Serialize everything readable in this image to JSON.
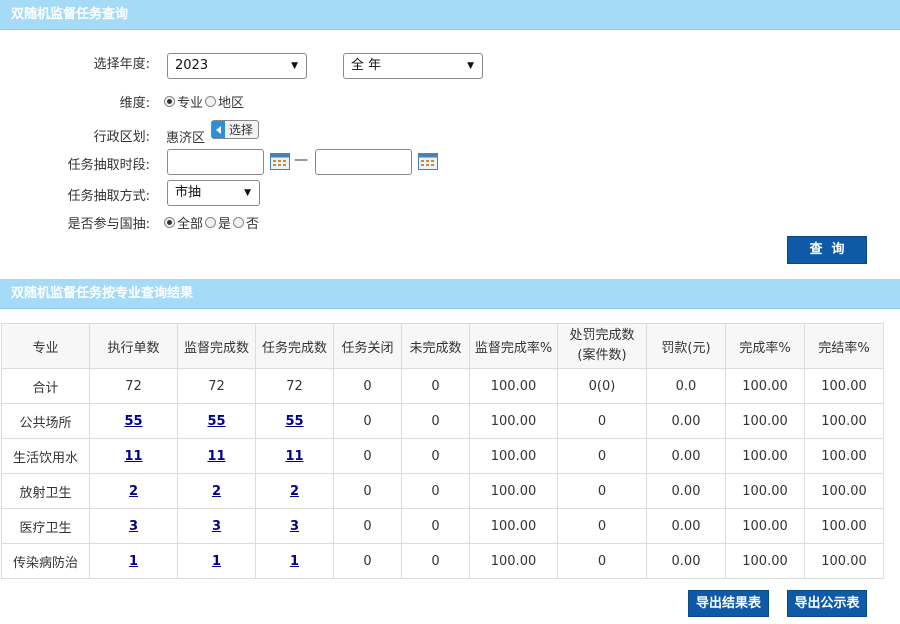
{
  "query_panel": {
    "title": "双随机监督任务查询"
  },
  "form": {
    "year": {
      "label": "选择年度:",
      "value": "2023"
    },
    "period": {
      "value": "全 年"
    },
    "dimension": {
      "label": "维度:",
      "options": [
        "专业",
        "地区"
      ],
      "selected": "专业"
    },
    "region": {
      "label": "行政区划:",
      "value": "惠济区",
      "select_button": "选择"
    },
    "time_range": {
      "label": "任务抽取时段:",
      "separator": "—",
      "start": "",
      "end": ""
    },
    "method": {
      "label": "任务抽取方式:",
      "value": "市抽"
    },
    "national": {
      "label": "是否参与国抽:",
      "options": [
        "全部",
        "是",
        "否"
      ],
      "selected": "全部"
    },
    "query_button": "查  询"
  },
  "results_panel": {
    "title": "双随机监督任务按专业查询结果"
  },
  "table": {
    "headers": [
      "专业",
      "执行单数",
      "监督完成数",
      "任务完成数",
      "任务关闭",
      "未完成数",
      "监督完成率%",
      "处罚完成数\n(案件数)",
      "罚款(元)",
      "完成率%",
      "完结率%"
    ],
    "rows": [
      [
        "合计",
        "72",
        "72",
        "72",
        "0",
        "0",
        "100.00",
        "0(0)",
        "0.0",
        "100.00",
        "100.00"
      ],
      [
        "公共场所",
        "55",
        "55",
        "55",
        "0",
        "0",
        "100.00",
        "0",
        "0.00",
        "100.00",
        "100.00"
      ],
      [
        "生活饮用水",
        "11",
        "11",
        "11",
        "0",
        "0",
        "100.00",
        "0",
        "0.00",
        "100.00",
        "100.00"
      ],
      [
        "放射卫生",
        "2",
        "2",
        "2",
        "0",
        "0",
        "100.00",
        "0",
        "0.00",
        "100.00",
        "100.00"
      ],
      [
        "医疗卫生",
        "3",
        "3",
        "3",
        "0",
        "0",
        "100.00",
        "0",
        "0.00",
        "100.00",
        "100.00"
      ],
      [
        "传染病防治",
        "1",
        "1",
        "1",
        "0",
        "0",
        "100.00",
        "0",
        "0.00",
        "100.00",
        "100.00"
      ]
    ]
  },
  "footer": {
    "export_results": "导出结果表",
    "export_public": "导出公示表"
  },
  "icons": {
    "calendar": "calendar-icon",
    "dropdown": "chevron-down-icon",
    "select_arrow": "triangle-left-icon"
  },
  "colors": {
    "header_bg": "#a6dbf7",
    "button_bg": "#0e5aa7",
    "link": "#00008b"
  }
}
